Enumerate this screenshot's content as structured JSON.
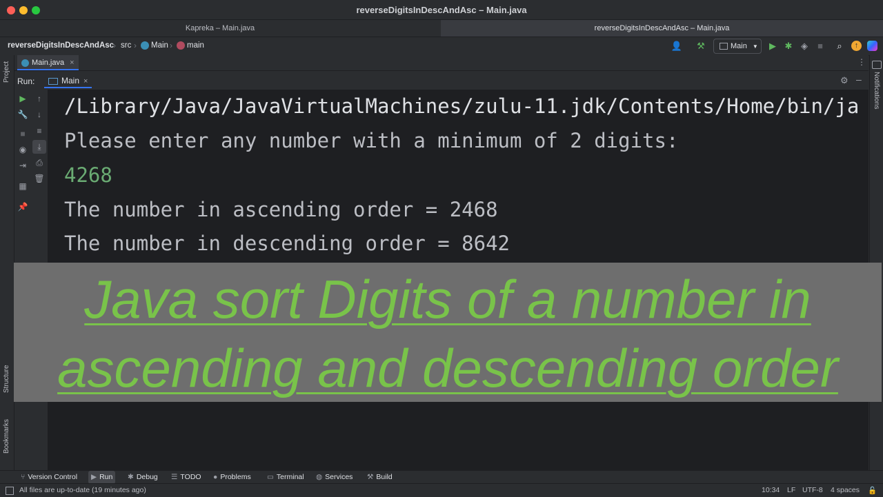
{
  "window": {
    "title": "reverseDigitsInDescAndAsc – Main.java"
  },
  "project_tabs": [
    {
      "label": "Kapreka – Main.java",
      "active": false
    },
    {
      "label": "reverseDigitsInDescAndAsc – Main.java",
      "active": true
    }
  ],
  "breadcrumb": {
    "project": "reverseDigitsInDescAndAsc",
    "folder": "src",
    "class": "Main",
    "method": "main"
  },
  "toolbar": {
    "run_config": "Main"
  },
  "editor_tabs": [
    {
      "label": "Main.java"
    }
  ],
  "run_panel": {
    "label": "Run:",
    "tab": "Main"
  },
  "left_stripe": {
    "project": "Project",
    "structure": "Structure",
    "bookmarks": "Bookmarks"
  },
  "right_stripe": {
    "notifications": "Notifications"
  },
  "console": {
    "lines": [
      {
        "text": "/Library/Java/JavaVirtualMachines/zulu-11.jdk/Contents/Home/bin/ja",
        "color": "#dfe1e5"
      },
      {
        "text": "Please enter any number with a minimum of 2 digits:",
        "color": "#bcbec4"
      },
      {
        "text": "4268",
        "color": "#6aab73"
      },
      {
        "text": "The number in ascending order = 2468",
        "color": "#bcbec4"
      },
      {
        "text": "The number in descending order = 8642",
        "color": "#bcbec4"
      }
    ]
  },
  "banner": {
    "line1": "Java sort Digits of a number in",
    "line2": "ascending and descending order",
    "text_color": "#79c34a",
    "bg_color": "#6e6e6e"
  },
  "tool_windows": [
    {
      "label": "Version Control",
      "icon": "branch-icon"
    },
    {
      "label": "Run",
      "icon": "run-icon",
      "active": true
    },
    {
      "label": "Debug",
      "icon": "bug-icon"
    },
    {
      "label": "TODO",
      "icon": "list-icon"
    },
    {
      "label": "Problems",
      "icon": "warning-icon"
    },
    {
      "label": "Terminal",
      "icon": "terminal-icon"
    },
    {
      "label": "Services",
      "icon": "services-icon"
    },
    {
      "label": "Build",
      "icon": "hammer-icon"
    }
  ],
  "status": {
    "message": "All files are up-to-date (19 minutes ago)",
    "position": "10:34",
    "line_sep": "LF",
    "encoding": "UTF-8",
    "indent": "4 spaces"
  },
  "colors": {
    "accent": "#3574f0",
    "run_green": "#5fb85f"
  }
}
